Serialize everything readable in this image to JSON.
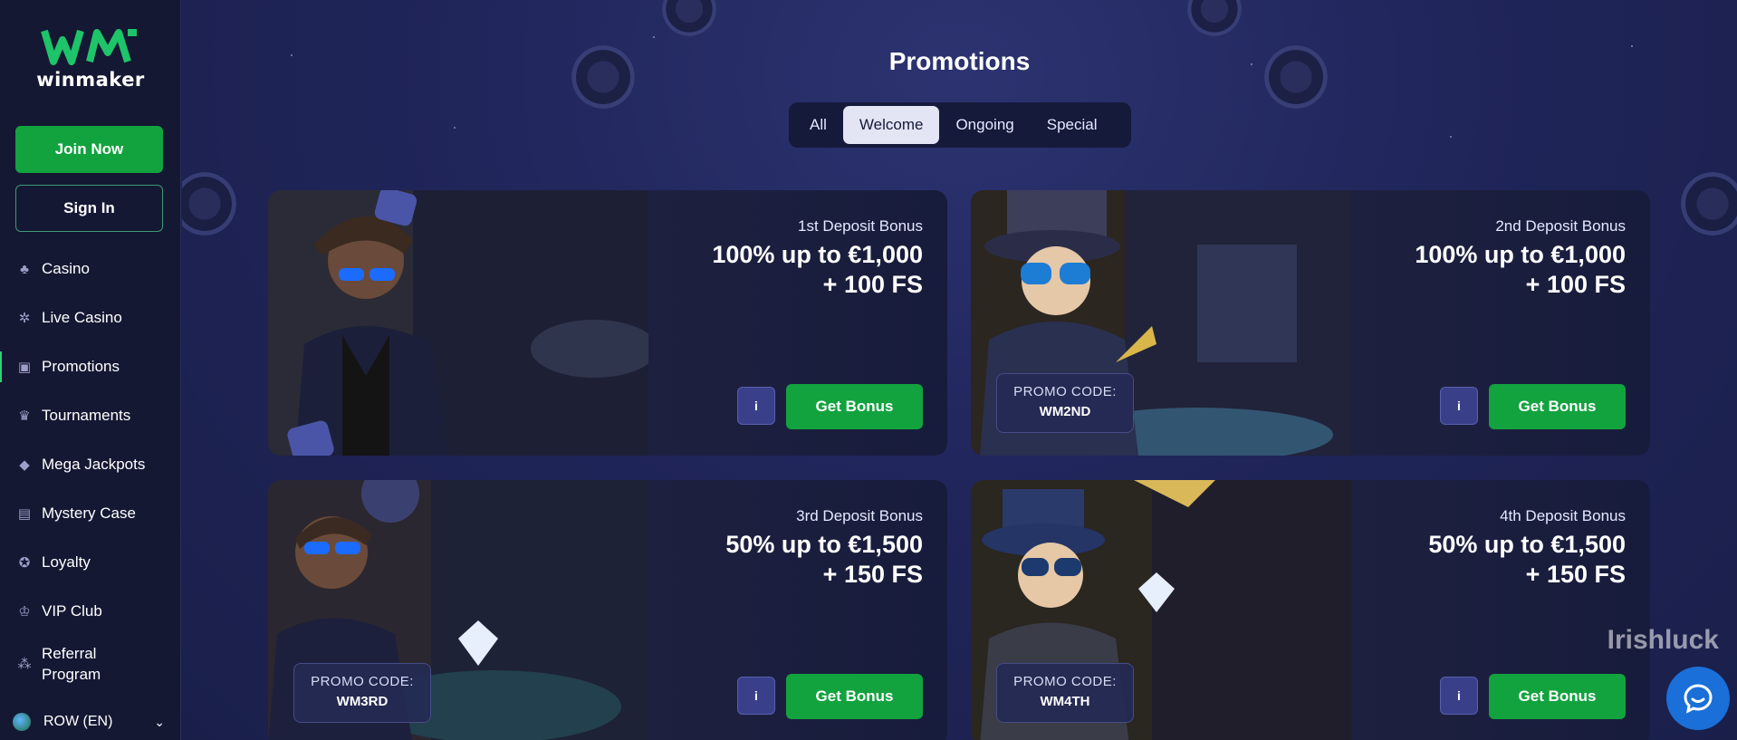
{
  "brand": {
    "logo_text": "winmaker"
  },
  "sidebar": {
    "join_label": "Join Now",
    "signin_label": "Sign In",
    "items": [
      {
        "label": "Casino",
        "icon": "casino-icon"
      },
      {
        "label": "Live Casino",
        "icon": "live-casino-icon"
      },
      {
        "label": "Promotions",
        "icon": "gift-icon",
        "active": true
      },
      {
        "label": "Tournaments",
        "icon": "trophy-icon"
      },
      {
        "label": "Mega Jackpots",
        "icon": "diamond-icon"
      },
      {
        "label": "Mystery Case",
        "icon": "briefcase-icon"
      },
      {
        "label": "Loyalty",
        "icon": "loyalty-icon"
      },
      {
        "label": "VIP Club",
        "icon": "crown-icon"
      },
      {
        "label": "Referral Program",
        "icon": "referral-icon"
      }
    ],
    "language": "ROW (EN)"
  },
  "main": {
    "title": "Promotions",
    "tabs": [
      {
        "label": "All"
      },
      {
        "label": "Welcome",
        "active": true
      },
      {
        "label": "Ongoing"
      },
      {
        "label": "Special"
      }
    ],
    "cards": [
      {
        "bonus_type": "1st Deposit Bonus",
        "amount_line1": "100% up to €1,000",
        "amount_line2": "+ 100 FS",
        "info": "i",
        "cta": "Get Bonus",
        "promo_label": "",
        "promo_code": ""
      },
      {
        "bonus_type": "2nd Deposit Bonus",
        "amount_line1": "100% up to €1,000",
        "amount_line2": "+ 100 FS",
        "info": "i",
        "cta": "Get Bonus",
        "promo_label": "PROMO CODE:",
        "promo_code": "WM2ND"
      },
      {
        "bonus_type": "3rd Deposit Bonus",
        "amount_line1": "50% up to €1,500",
        "amount_line2": "+ 150 FS",
        "info": "i",
        "cta": "Get Bonus",
        "promo_label": "PROMO CODE:",
        "promo_code": "WM3RD"
      },
      {
        "bonus_type": "4th Deposit Bonus",
        "amount_line1": "50% up to €1,500",
        "amount_line2": "+ 150 FS",
        "info": "i",
        "cta": "Get Bonus",
        "promo_label": "PROMO CODE:",
        "promo_code": "WM4TH"
      }
    ]
  },
  "watermark": "Irishluck",
  "colors": {
    "accent_green": "#12a33f",
    "sidebar_bg": "#141833",
    "main_bg": "#1e2150",
    "chat_blue": "#1a6fd8"
  }
}
